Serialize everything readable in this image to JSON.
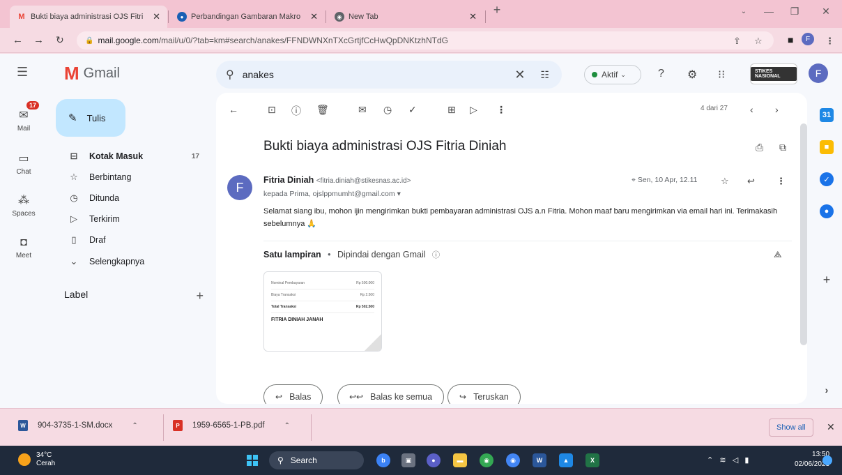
{
  "browser": {
    "tabs": [
      {
        "title": "Bukti biaya administrasi OJS Fitri",
        "icon": "gmail-icon"
      },
      {
        "title": "Perbandingan Gambaran Makro",
        "icon": "journal-icon"
      },
      {
        "title": "New Tab",
        "icon": "chrome-icon"
      }
    ],
    "url_host": "mail.google.com",
    "url_path": "/mail/u/0/?tab=km#search/anakes/FFNDWNXnTXcGrtjfCcHwQpDNKtzhNTdG"
  },
  "gmail": {
    "product_name": "Gmail",
    "compose_label": "Tulis",
    "rail": [
      {
        "label": "Mail",
        "icon": "mail-icon"
      },
      {
        "label": "Chat",
        "icon": "chat-icon"
      },
      {
        "label": "Spaces",
        "icon": "spaces-icon"
      },
      {
        "label": "Meet",
        "icon": "video-icon"
      }
    ],
    "mail_badge": "17",
    "nav": [
      {
        "label": "Kotak Masuk",
        "count": "17",
        "icon": "inbox-icon"
      },
      {
        "label": "Berbintang",
        "count": "",
        "icon": "star-icon"
      },
      {
        "label": "Ditunda",
        "count": "",
        "icon": "clock-icon"
      },
      {
        "label": "Terkirim",
        "count": "",
        "icon": "send-icon"
      },
      {
        "label": "Draf",
        "count": "",
        "icon": "draft-icon"
      },
      {
        "label": "Selengkapnya",
        "count": "",
        "icon": "chevron-down-icon"
      }
    ],
    "labels_header": "Label",
    "search": {
      "value": "anakes"
    },
    "status": "Aktif",
    "org_logo_text": "STIKES NASIONAL",
    "account_initial": "F"
  },
  "message": {
    "pager": "4 dari 27",
    "subject": "Bukti biaya administrasi OJS Fitria Diniah",
    "sender_name": "Fitria Diniah",
    "sender_email": "<fitria.diniah@stikesnas.ac.id>",
    "sender_initial": "F",
    "recipients": "kepada Prima, ojslppmumht@gmail.com",
    "date": "Sen, 10 Apr, 12.11",
    "body": "Selamat siang ibu, mohon ijin mengirimkan bukti pembayaran administrasi OJS a.n Fitria. Mohon maaf baru mengirimkan via email hari ini. Terimakasih sebelumnya 🙏",
    "attachment_header": "Satu lampiran",
    "attachment_scan": "Dipindai dengan Gmail",
    "thumbnail": {
      "row1_label": "Nominal Pembayaran",
      "row1_value": "Rp 500.000",
      "row2_label": "Biaya Transaksi",
      "row2_value": "Rp 2.500",
      "row3_label": "Total Transaksi",
      "row3_value": "Rp 502.500",
      "name": "FITRIA DINIAH JANAH"
    },
    "reply_buttons": [
      "Balas",
      "Balas ke semua",
      "Teruskan"
    ]
  },
  "downloads": {
    "items": [
      {
        "name": "904-3735-1-SM.docx",
        "type": "W",
        "color": "#2b579a"
      },
      {
        "name": "1959-6565-1-PB.pdf",
        "type": "P",
        "color": "#d93025"
      }
    ],
    "show_all": "Show all"
  },
  "taskbar": {
    "temperature": "34°C",
    "weather": "Cerah",
    "search": "Search",
    "time": "13:50",
    "date": "02/06/2023"
  }
}
